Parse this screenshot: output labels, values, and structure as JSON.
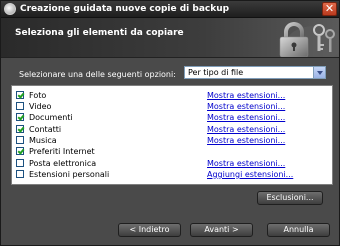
{
  "window": {
    "title": "Creazione guidata nuove copie di backup",
    "close_glyph": "✕",
    "icons": {
      "app": "backup-app-icon",
      "close": "close-icon"
    }
  },
  "banner": {
    "heading": "Seleziona gli elementi da copiare",
    "art": "padlock-keys-icon"
  },
  "options": {
    "label": "Selezionare una delle seguenti opzioni:",
    "selected": "Per tipo di file"
  },
  "items": [
    {
      "label": "Foto",
      "checked": true,
      "link": "Mostra estensioni..."
    },
    {
      "label": "Video",
      "checked": false,
      "link": "Mostra estensioni..."
    },
    {
      "label": "Documenti",
      "checked": true,
      "link": "Mostra estensioni..."
    },
    {
      "label": "Contatti",
      "checked": true,
      "link": "Mostra estensioni..."
    },
    {
      "label": "Musica",
      "checked": false,
      "link": "Mostra estensioni..."
    },
    {
      "label": "Preferiti Internet",
      "checked": true,
      "link": ""
    },
    {
      "label": "Posta elettronica",
      "checked": false,
      "link": "Mostra estensioni..."
    },
    {
      "label": "Estensioni personali",
      "checked": false,
      "link": "Aggiungi estensioni..."
    }
  ],
  "buttons": {
    "exclusions": "Esclusioni...",
    "back": "< Indietro",
    "next": "Avanti >",
    "cancel": "Annulla"
  }
}
